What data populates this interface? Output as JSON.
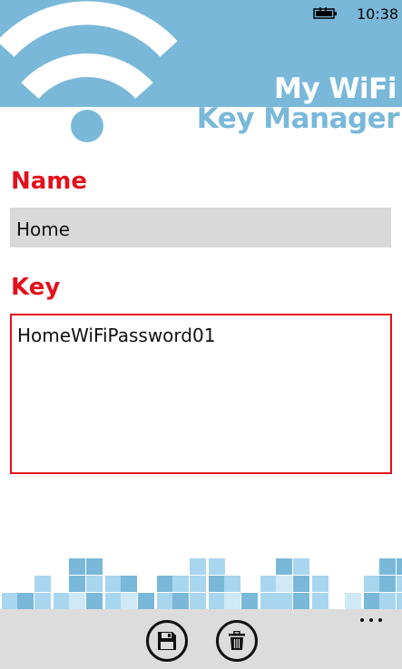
{
  "status_bar": {
    "time": "10:38",
    "battery_icon": "battery-charging-icon"
  },
  "header": {
    "logo_icon": "wifi-icon",
    "title_line1": "My WiFi",
    "title_line2": "Key Manager",
    "colors": {
      "header_bg": "#79b8d9",
      "accent": "#e3111b"
    }
  },
  "form": {
    "name_label": "Name",
    "name_value": "Home",
    "key_label": "Key",
    "key_value": "HomeWiFiPassword01"
  },
  "app_bar": {
    "save_icon": "floppy-disk-icon",
    "delete_icon": "trash-icon",
    "more_icon": "ellipsis-icon"
  }
}
